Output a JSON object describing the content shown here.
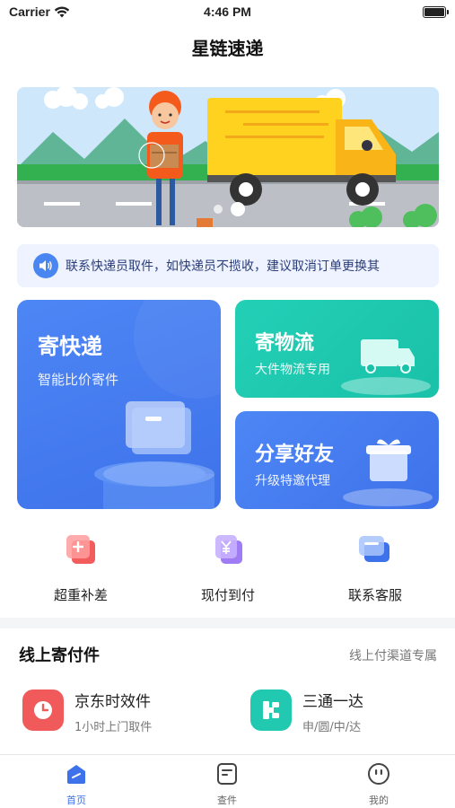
{
  "status_bar": {
    "carrier": "Carrier",
    "time": "4:46 PM"
  },
  "nav": {
    "title": "星链速递"
  },
  "notice": {
    "text": "联系快递员取件，如快递员不揽收，建议取消订单更换其"
  },
  "cards": {
    "send": {
      "title": "寄快递",
      "subtitle": "智能比价寄件"
    },
    "logistics": {
      "title": "寄物流",
      "subtitle": "大件物流专用"
    },
    "share": {
      "title": "分享好友",
      "subtitle": "升级特邀代理"
    }
  },
  "quick_actions": [
    {
      "label": "超重补差",
      "icon": "plus-icon"
    },
    {
      "label": "现付到付",
      "icon": "yen-icon"
    },
    {
      "label": "联系客服",
      "icon": "support-icon"
    }
  ],
  "section": {
    "title": "线上寄付件",
    "note": "线上付渠道专属"
  },
  "services": [
    {
      "name": "京东时效件",
      "desc": "1小时上门取件",
      "icon": "clock-icon",
      "color": "#f05a5a"
    },
    {
      "name": "三通一达",
      "desc": "申/圆/中/达",
      "icon": "grid-icon",
      "color": "#20c9b0"
    }
  ],
  "tabs": [
    {
      "label": "首页",
      "icon": "home-icon",
      "active": true
    },
    {
      "label": "查件",
      "icon": "search-doc-icon",
      "active": false
    },
    {
      "label": "我的",
      "icon": "profile-icon",
      "active": false
    }
  ],
  "colors": {
    "primary": "#3e72ea",
    "teal": "#1fc6ad",
    "notice_bg": "#eef3ff"
  }
}
